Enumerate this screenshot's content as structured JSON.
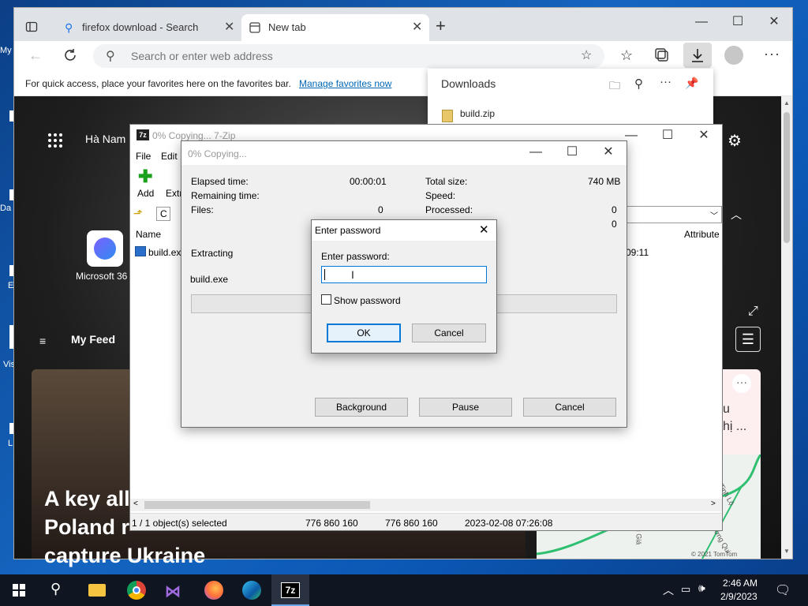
{
  "desktop": {
    "icon_labels": [
      "My",
      "Da",
      "E",
      "Vis",
      "L"
    ]
  },
  "browser": {
    "tabs": [
      {
        "title": "firefox download - Search",
        "icon": "search-icon"
      },
      {
        "title": "New tab",
        "icon": "newtab-icon"
      }
    ],
    "address_placeholder": "Search or enter web address",
    "favorites_message": "For quick access, place your favorites here on the favorites bar.",
    "favorites_link": "Manage favorites now",
    "newtab": {
      "location": "Hà Nam",
      "app_label": "Microsoft 36",
      "feed_label": "My Feed",
      "headline_lines": [
        "A key all",
        "Poland r",
        "capture Ukraine"
      ],
      "right_card_text": [
        "u",
        "hị ..."
      ],
      "map_labels": [
        "Tinh Lộ",
        "Đường Qui",
        "ng Giá",
        "© 2021 TomTom"
      ]
    },
    "downloads": {
      "title": "Downloads",
      "item": "build.zip"
    }
  },
  "zip_main": {
    "title": "0% Copying... 7-Zip",
    "menu": [
      "File",
      "Edit"
    ],
    "toolbar": [
      "Add",
      "Extr"
    ],
    "path_prefix": "C",
    "columns": {
      "name": "Name",
      "attributes": "Attribute"
    },
    "file_name": "build.exe",
    "file_time": "09:11",
    "status": {
      "selected": "1 / 1 object(s) selected",
      "size": "776 860 160",
      "packed": "776 860 160",
      "modified": "2023-02-08 07:26:08"
    }
  },
  "copy_dialog": {
    "title": "0% Copying...",
    "elapsed_label": "Elapsed time:",
    "elapsed_value": "00:00:01",
    "remaining_label": "Remaining time:",
    "files_label": "Files:",
    "files_value": "0",
    "total_label": "Total size:",
    "total_value": "740 MB",
    "speed_label": "Speed:",
    "processed_label": "Processed:",
    "processed_value": "0",
    "extra_value": "0",
    "action": "Extracting",
    "current_file": "build.exe",
    "progress": 0,
    "buttons": {
      "background": "Background",
      "pause": "Pause",
      "cancel": "Cancel"
    }
  },
  "password_dialog": {
    "title": "Enter password",
    "label": "Enter password:",
    "value": "",
    "show_password": "Show password",
    "ok": "OK",
    "cancel": "Cancel"
  },
  "taskbar": {
    "time": "2:46 AM",
    "date": "2/9/2023"
  },
  "colors": {
    "desktop": "#1565c0",
    "taskbar": "#101621",
    "link": "#0066b4",
    "focus": "#0078d7"
  }
}
